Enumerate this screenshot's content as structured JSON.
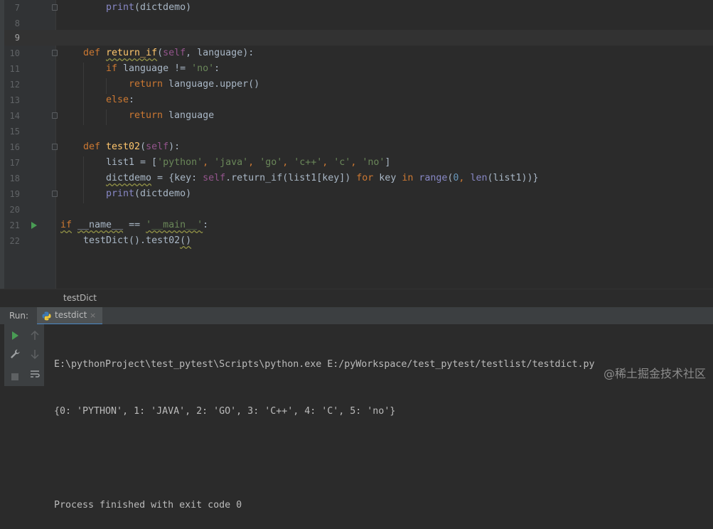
{
  "editor": {
    "lines": [
      {
        "n": "7"
      },
      {
        "n": "8"
      },
      {
        "n": "9"
      },
      {
        "n": "10"
      },
      {
        "n": "11"
      },
      {
        "n": "12"
      },
      {
        "n": "13"
      },
      {
        "n": "14"
      },
      {
        "n": "15"
      },
      {
        "n": "16"
      },
      {
        "n": "17"
      },
      {
        "n": "18"
      },
      {
        "n": "19"
      },
      {
        "n": "20"
      },
      {
        "n": "21"
      },
      {
        "n": "22"
      }
    ],
    "code": {
      "l7_print": "print",
      "l7_rest": "(dictdemo)",
      "l10_def": "def ",
      "l10_name": "return_if",
      "l10_self": "self",
      "l10_rest": ", language):",
      "l11_if": "if ",
      "l11_mid": "language != ",
      "l11_str": "'no'",
      "l11_end": ":",
      "l12_return": "return ",
      "l12_rest": "language.upper()",
      "l13_else": "else",
      "l13_end": ":",
      "l14_return": "return ",
      "l14_rest": "language",
      "l16_def": "def ",
      "l16_name": "test02",
      "l16_self": "self",
      "l16_end": "):",
      "l17_start": "list1 = [",
      "l17_s1": "'python'",
      "l17_s2": "'java'",
      "l17_s3": "'go'",
      "l17_s4": "'c++'",
      "l17_s5": "'c'",
      "l17_s6": "'no'",
      "l17_end": "]",
      "l18_a": "dictdemo",
      "l18_b": " = {key: ",
      "l18_self": "self",
      "l18_c": ".return_if(list1[key]) ",
      "l18_for": "for",
      "l18_d": " key ",
      "l18_in": "in",
      "l18_range": "range",
      "l18_zero": "0",
      "l18_len": "len",
      "l18_e": "(list1))}",
      "l19_print": "print",
      "l19_rest": "(dictdemo)",
      "l21_if": "if",
      "l21_name": "__name__",
      "l21_eq": " == ",
      "l21_str": "'__main__'",
      "l21_end": ":",
      "l22_a": "testDict().test02",
      "l22_b": "()"
    }
  },
  "breadcrumb": {
    "label": "testDict"
  },
  "run": {
    "label": "Run:",
    "tab_label": "testdict",
    "tab_close": "×",
    "console": [
      "E:\\pythonProject\\test_pytest\\Scripts\\python.exe E:/pyWorkspace/test_pytest/testlist/testdict.py",
      "{0: 'PYTHON', 1: 'JAVA', 2: 'GO', 3: 'C++', 4: 'C', 5: 'no'}",
      "",
      "Process finished with exit code 0"
    ]
  },
  "watermark": "@稀土掘金技术社区",
  "icons": {
    "run": "run-icon",
    "rerun_up": "up-arrow-icon",
    "down": "down-arrow-icon",
    "wrench": "wrench-icon",
    "stop": "stop-icon",
    "soft_wrap": "soft-wrap-icon",
    "python": "python-icon"
  },
  "colors": {
    "keyword": "#cc7832",
    "function": "#ffc66d",
    "string": "#6a8759",
    "number": "#6897bb",
    "self": "#94558d",
    "builtin": "#8888c6"
  }
}
